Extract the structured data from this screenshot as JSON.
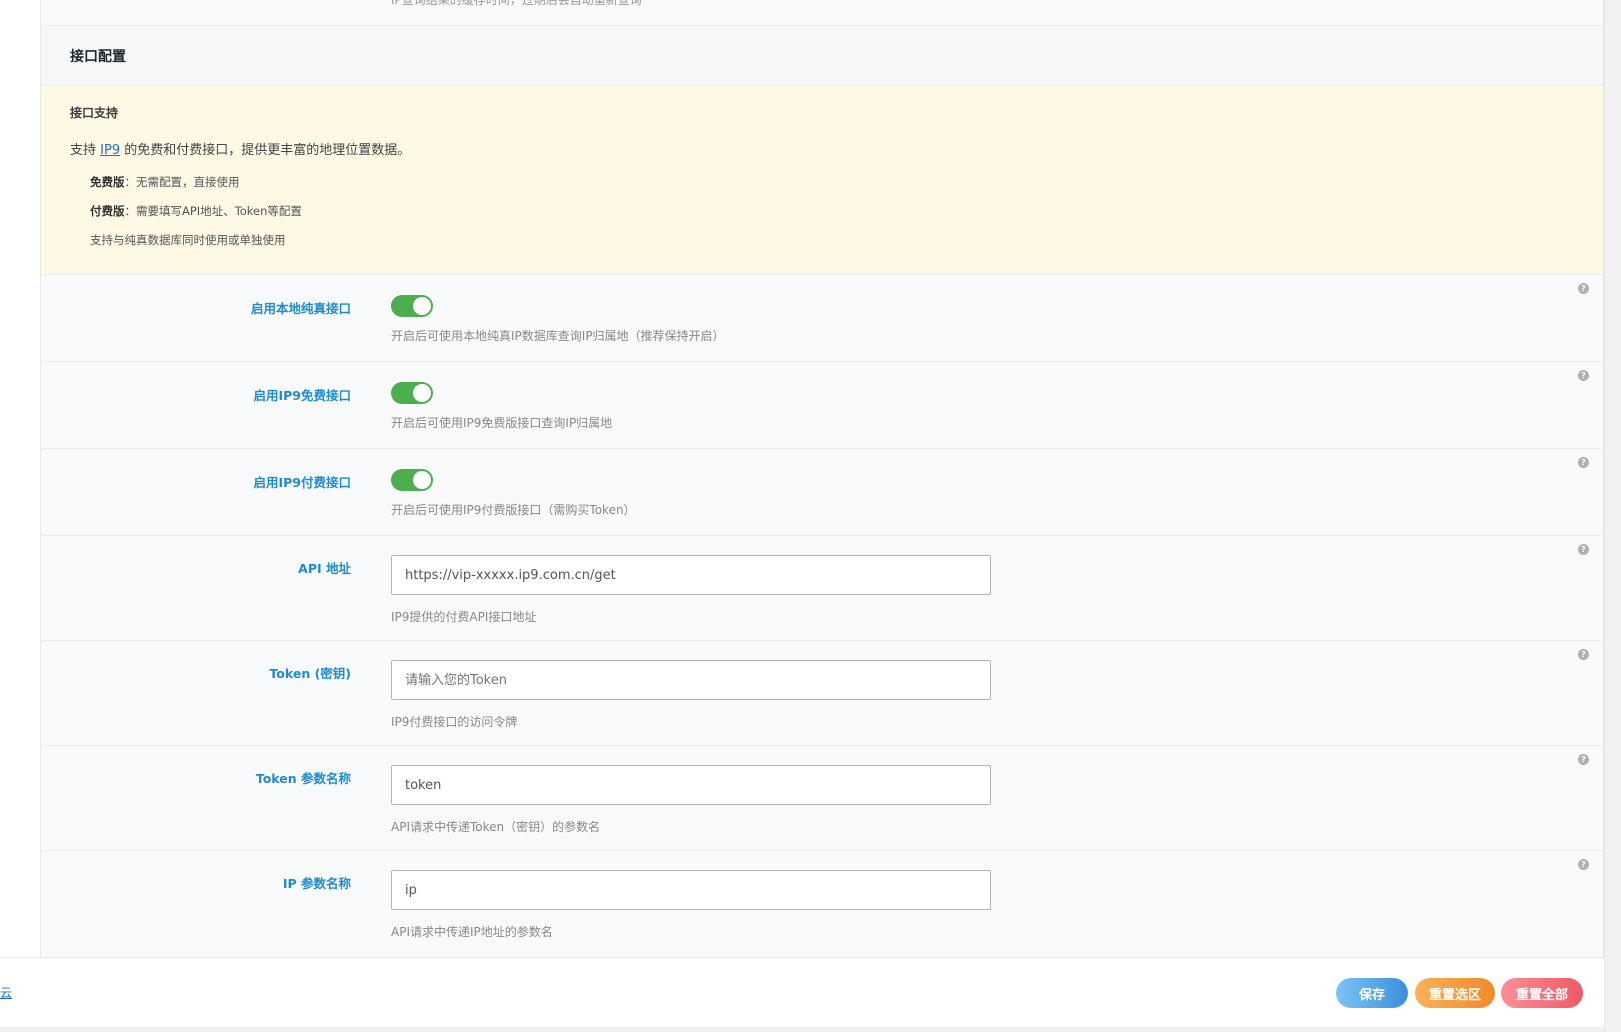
{
  "prev_section": {
    "desc": "IP查询结果的缓存时间，过期后会自动重新查询"
  },
  "section": {
    "title": "接口配置"
  },
  "notice": {
    "title": "接口支持",
    "desc_prefix": "支持",
    "desc_link": "IP9",
    "desc_suffix": "的免费和付费接口，提供更丰富的地理位置数据。",
    "items": [
      {
        "label": "免费版",
        "text": "：无需配置，直接使用"
      },
      {
        "label": "付费版",
        "text": "：需要填写API地址、Token等配置"
      },
      {
        "label": "",
        "text": "支持与纯真数据库同时使用或单独使用"
      }
    ]
  },
  "fields": {
    "local_qqwry": {
      "label": "启用本地纯真接口",
      "desc": "开启后可使用本地纯真IP数据库查询IP归属地（推荐保持开启）",
      "enabled": true
    },
    "ip9_free": {
      "label": "启用IP9免费接口",
      "desc": "开启后可使用IP9免费版接口查询IP归属地",
      "enabled": true
    },
    "ip9_paid": {
      "label": "启用IP9付费接口",
      "desc": "开启后可使用IP9付费版接口（需购买Token）",
      "enabled": true
    },
    "api_url": {
      "label": "API 地址",
      "value": "https://vip-xxxxx.ip9.com.cn/get",
      "desc": "IP9提供的付费API接口地址"
    },
    "token": {
      "label": "Token (密钥)",
      "placeholder": "请输入您的Token",
      "desc": "IP9付费接口的访问令牌"
    },
    "token_param": {
      "label": "Token 参数名称",
      "value": "token",
      "desc": "API请求中传递Token（密钥）的参数名"
    },
    "ip_param": {
      "label": "IP 参数名称",
      "value": "ip",
      "desc": "API请求中传递IP地址的参数名"
    }
  },
  "help_glyph": "?",
  "footer": {
    "link": "云",
    "save": "保存",
    "reset_section": "重置选区",
    "reset_all": "重置全部"
  },
  "colors": {
    "label_blue": "#1e8cd4",
    "toggle_on": "#4cae4c",
    "notice_bg": "#fdf9e5"
  }
}
